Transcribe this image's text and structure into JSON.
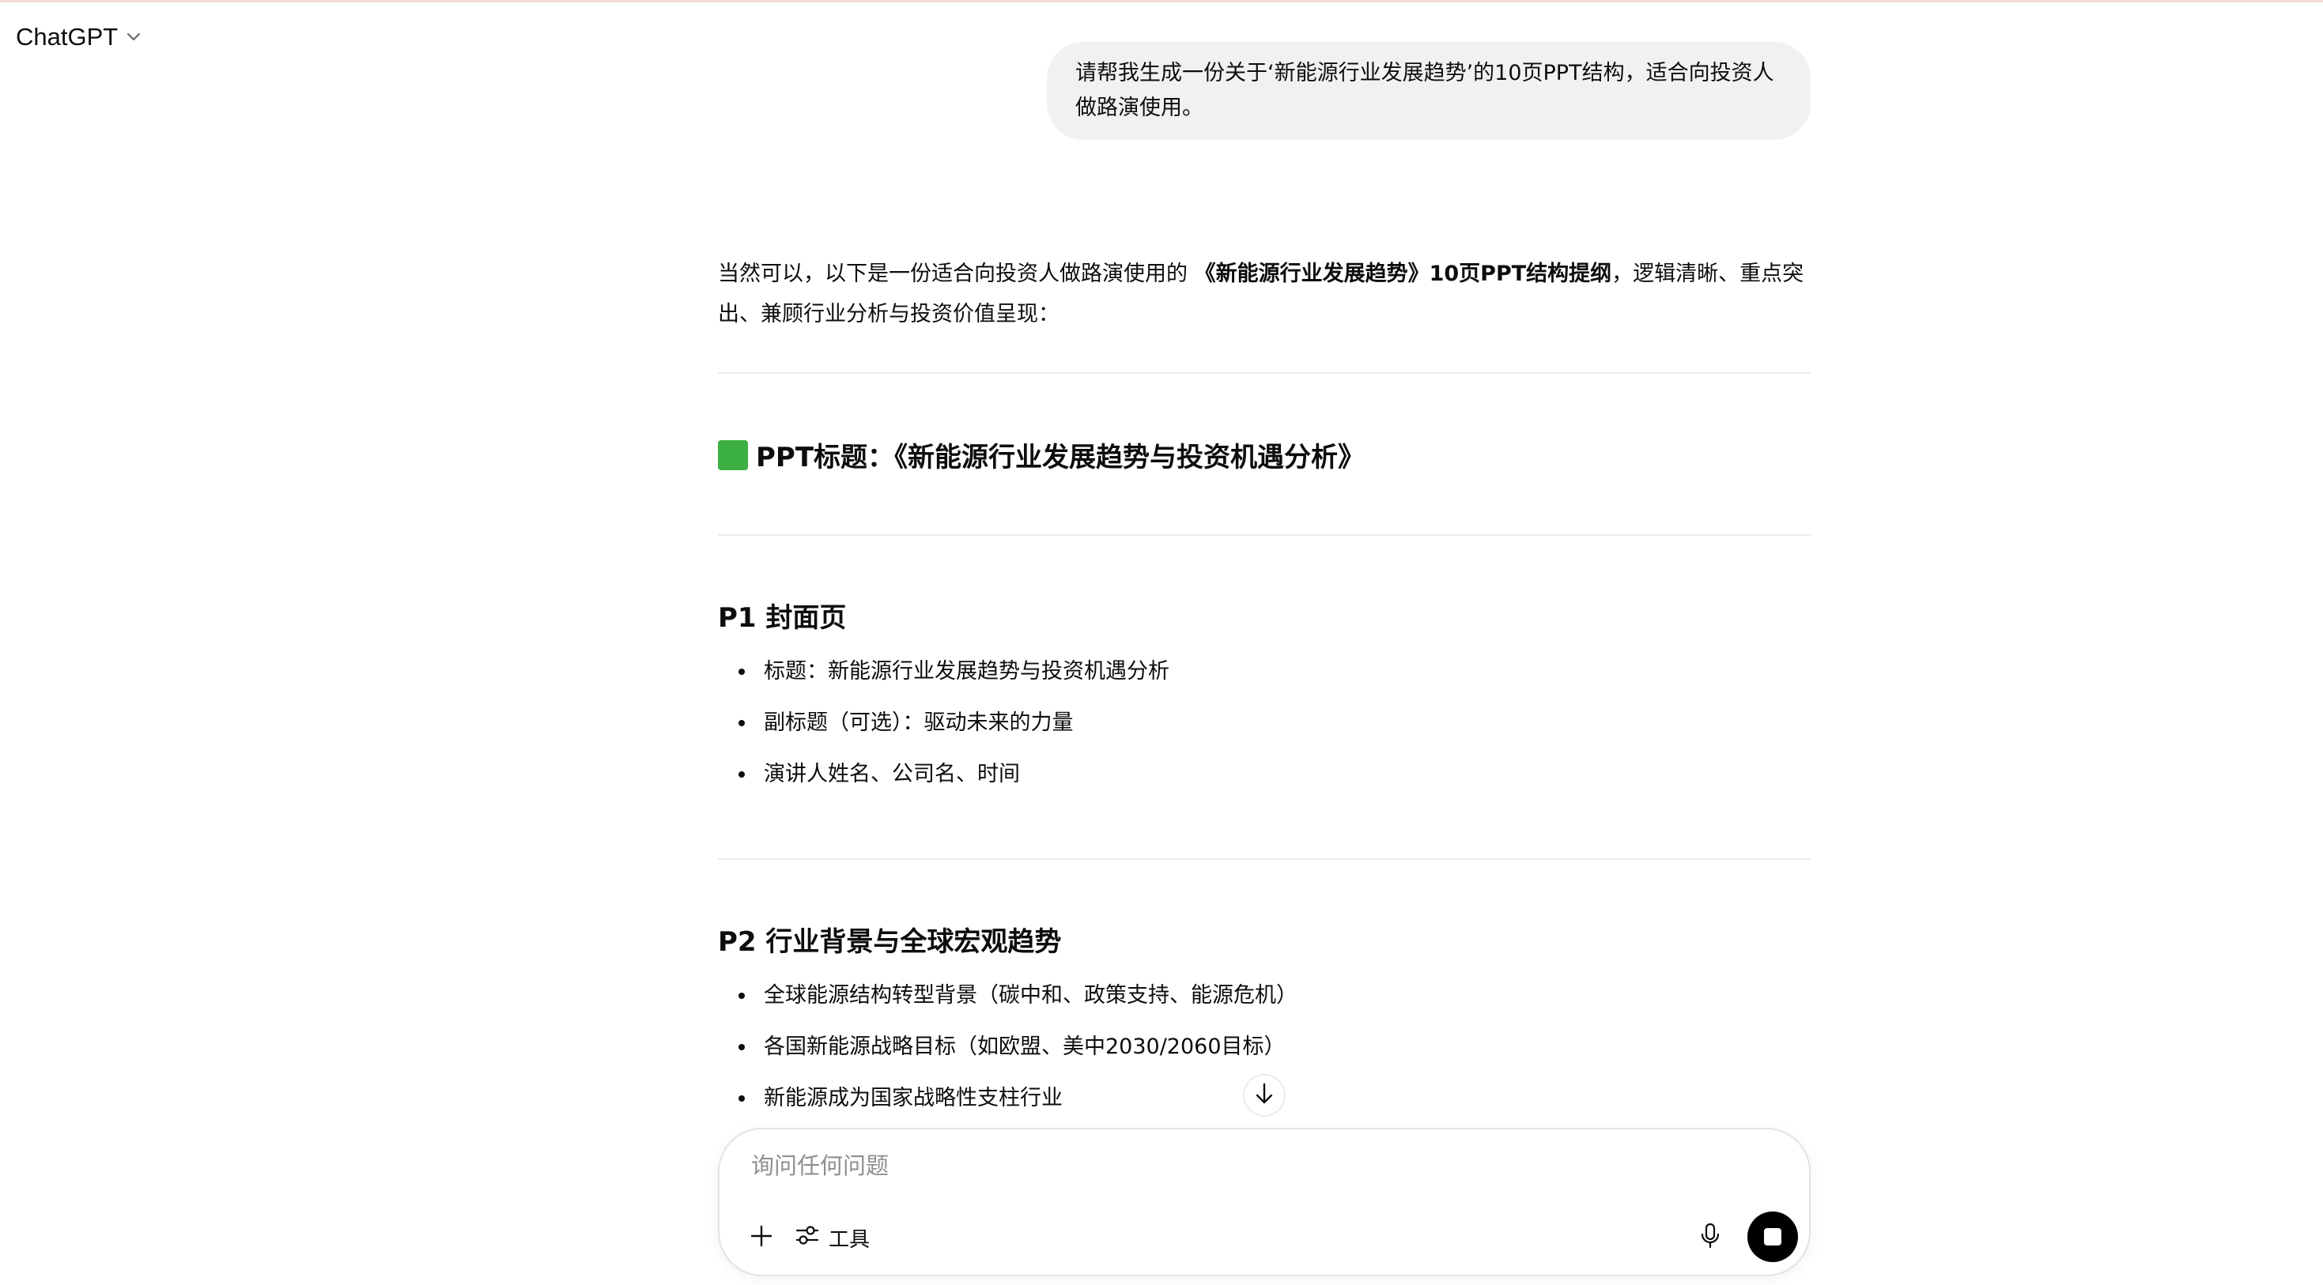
{
  "header": {
    "model_name": "ChatGPT"
  },
  "user_message": {
    "text": "请帮我生成一份关于‘新能源行业发展趋势’的10页PPT结构，适合向投资人做路演使用。"
  },
  "assistant": {
    "intro_before": "当然可以，以下是一份适合向投资人做路演使用的",
    "intro_bold": "《新能源行业发展趋势》10页PPT结构提纲",
    "intro_after": "，逻辑清晰、重点突出、兼顾行业分析与投资价值呈现：",
    "ppt_title": "PPT标题：《新能源行业发展趋势与投资机遇分析》",
    "sections": [
      {
        "title": "P1 封面页",
        "items": [
          "标题：新能源行业发展趋势与投资机遇分析",
          "副标题（可选）：驱动未来的力量",
          "演讲人姓名、公司名、时间"
        ]
      },
      {
        "title": "P2 行业背景与全球宏观趋势",
        "items": [
          "全球能源结构转型背景（碳中和、政策支持、能源危机）",
          "各国新能源战略目标（如欧盟、美中2030/2060目标）",
          "新能源成为国家战略性支柱行业"
        ]
      }
    ]
  },
  "composer": {
    "placeholder": "询问任何问题",
    "tools_label": "工具"
  },
  "icons": {
    "chevron": "chevron-down-icon",
    "green_square": "green-square-icon",
    "scroll_down": "arrow-down-icon",
    "plus": "plus-icon",
    "tools": "sliders-icon",
    "mic": "microphone-icon",
    "stop": "stop-icon"
  },
  "colors": {
    "bubble": "#f1f1f1",
    "green_square": "#3cb043",
    "stop_button": "#000000"
  }
}
